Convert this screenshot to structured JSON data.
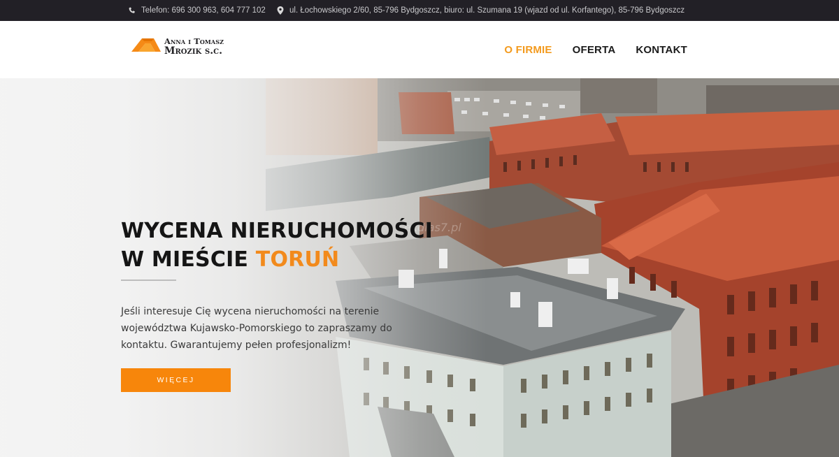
{
  "topbar": {
    "phone_icon": "phone-icon",
    "phone": "Telefon: 696 300 963, 604 777 102",
    "address_icon": "map-marker-icon",
    "address": "ul. Łochowskiego 2/60, 85-796 Bydgoszcz, biuro: ul. Szumana 19 (wjazd od ul. Korfantego), 85-796 Bydgoszcz"
  },
  "logo": {
    "line1": "Anna i Tomasz",
    "line2": "Mrozik s.c.",
    "icon": "roof-logo-icon"
  },
  "nav": {
    "items": [
      {
        "label": "O FIRMIE",
        "active": true
      },
      {
        "label": "OFERTA",
        "active": false
      },
      {
        "label": "KONTAKT",
        "active": false
      }
    ]
  },
  "hero": {
    "title_line1": "WYCENA NIERUCHOMOŚCI",
    "title_line2_prefix": "W MIEŚCIE ",
    "title_city": "TORUŃ",
    "description": "Jeśli interesuje Cię wycena nieruchomości na terenie województwa Kujawsko-Pomorskiego to zapraszamy do kontaktu. Gwarantujemy pełen profesjonalizm!",
    "button_label": "WIĘCEJ",
    "watermark": "ekdlas7.pl"
  },
  "colors": {
    "accent": "#f7860b",
    "topbar_bg": "#222026",
    "text_dark": "#151515"
  }
}
